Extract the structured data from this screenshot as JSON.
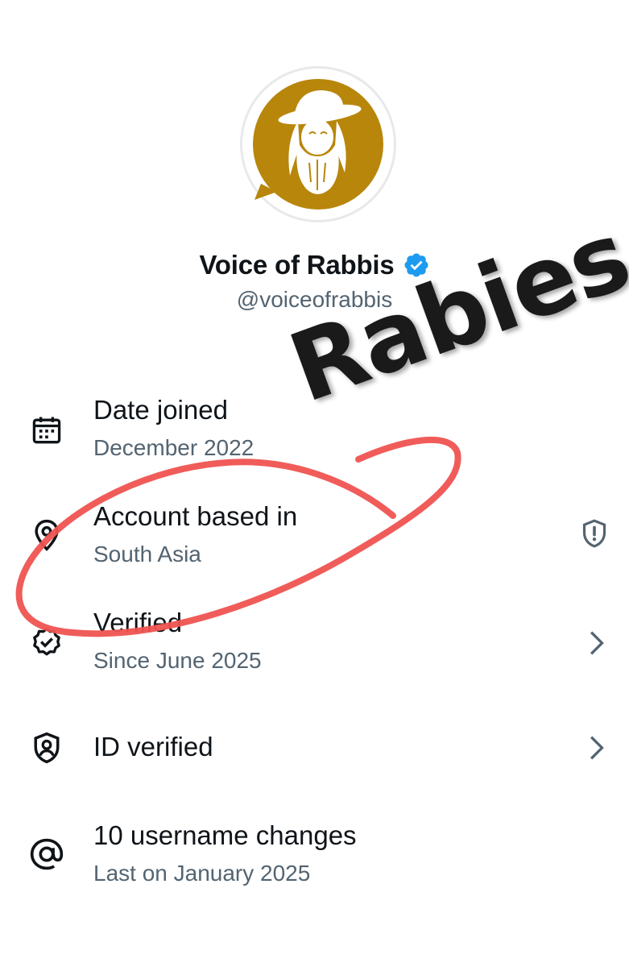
{
  "profile": {
    "display_name": "Voice of Rabbis",
    "handle": "@voiceofrabbis",
    "avatar": {
      "icon": "rabbi-portrait-avatar",
      "background_color": "#b8860b"
    },
    "verified_badge": "verified-badge-icon"
  },
  "about_rows": [
    {
      "icon": "calendar-icon",
      "title": "Date joined",
      "subtitle": "December 2022"
    },
    {
      "icon": "location-pin-icon",
      "title": "Account based in",
      "subtitle": "South Asia",
      "right_icon": "shield-alert-icon"
    },
    {
      "icon": "verified-seal-icon",
      "title": "Verified",
      "subtitle": "Since June 2025",
      "right_icon": "chevron-right-icon"
    },
    {
      "icon": "id-shield-icon",
      "title": "ID verified",
      "right_icon": "chevron-right-icon"
    },
    {
      "icon": "at-sign-icon",
      "title": "10 username changes",
      "subtitle": "Last on January 2025"
    }
  ],
  "annotation": {
    "text": "Rabies",
    "circle_color": "#ef5350"
  },
  "colors": {
    "primary_text": "#0f1419",
    "secondary_text": "#536471",
    "verified_blue": "#1d9bf0"
  }
}
